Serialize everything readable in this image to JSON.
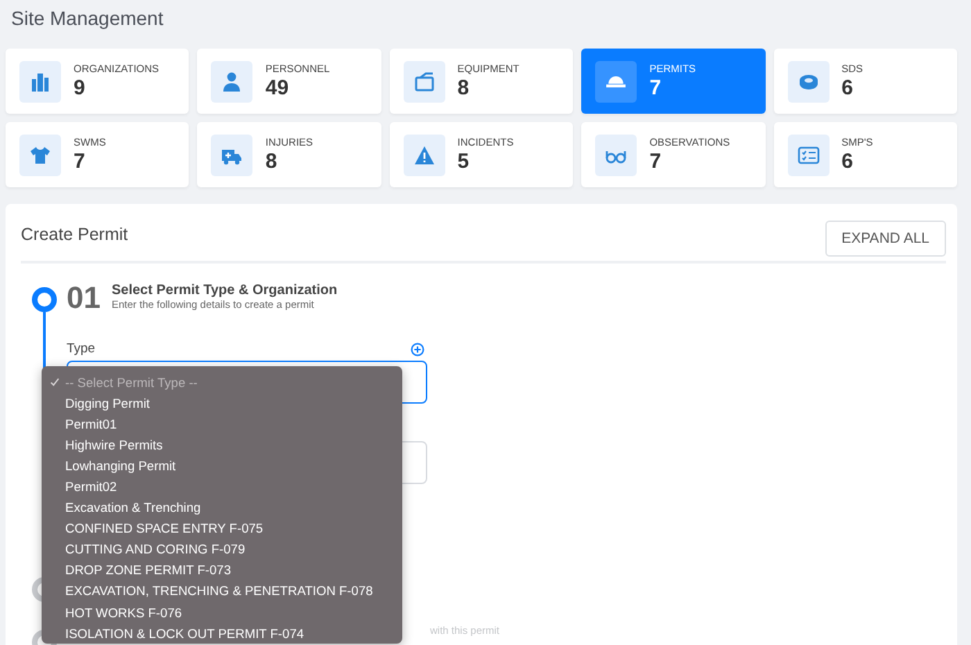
{
  "page_title": "Site Management",
  "cards": [
    {
      "label": "ORGANIZATIONS",
      "count": "9",
      "selected": false
    },
    {
      "label": "PERSONNEL",
      "count": "49",
      "selected": false
    },
    {
      "label": "EQUIPMENT",
      "count": "8",
      "selected": false
    },
    {
      "label": "PERMITS",
      "count": "7",
      "selected": true
    },
    {
      "label": "SDS",
      "count": "6",
      "selected": false
    },
    {
      "label": "SWMS",
      "count": "7",
      "selected": false
    },
    {
      "label": "INJURIES",
      "count": "8",
      "selected": false
    },
    {
      "label": "INCIDENTS",
      "count": "5",
      "selected": false
    },
    {
      "label": "OBSERVATIONS",
      "count": "7",
      "selected": false
    },
    {
      "label": "SMP'S",
      "count": "6",
      "selected": false
    }
  ],
  "panel": {
    "title": "Create Permit",
    "expand_button": "EXPAND ALL",
    "steps": [
      {
        "number": "01",
        "title": "Select Permit Type & Organization",
        "subtitle": "Enter the following details to create a permit",
        "active": true
      },
      {
        "active": false
      },
      {
        "active": false
      }
    ],
    "type_field": {
      "label": "Type",
      "focused": true
    },
    "hint_fragment": "with this permit",
    "dropdown": {
      "options": [
        {
          "label": "-- Select Permit Type --",
          "selected": true,
          "disabled": true
        },
        {
          "label": "Digging Permit",
          "selected": false,
          "disabled": false
        },
        {
          "label": "Permit01",
          "selected": false,
          "disabled": false
        },
        {
          "label": "Highwire Permits",
          "selected": false,
          "disabled": false
        },
        {
          "label": "Lowhanging Permit",
          "selected": false,
          "disabled": false
        },
        {
          "label": "Permit02",
          "selected": false,
          "disabled": false
        },
        {
          "label": "Excavation & Trenching",
          "selected": false,
          "disabled": false
        },
        {
          "label": "CONFINED SPACE ENTRY F-075",
          "selected": false,
          "disabled": false
        },
        {
          "label": "CUTTING AND CORING F-079",
          "selected": false,
          "disabled": false
        },
        {
          "label": "DROP ZONE PERMIT F-073",
          "selected": false,
          "disabled": false
        },
        {
          "label": "EXCAVATION, TRENCHING & PENETRATION F-078",
          "selected": false,
          "disabled": false
        },
        {
          "label": "HOT WORKS F-076",
          "selected": false,
          "disabled": false
        },
        {
          "label": "ISOLATION & LOCK OUT PERMIT F-074",
          "selected": false,
          "disabled": false
        }
      ]
    }
  }
}
